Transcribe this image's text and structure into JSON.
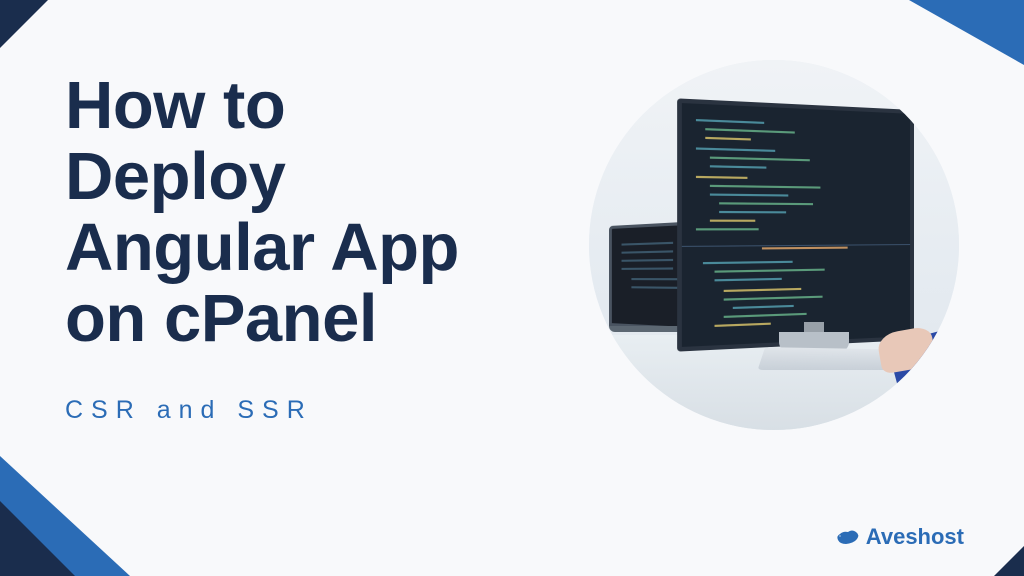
{
  "title_lines": [
    "How to",
    "Deploy",
    "Angular App",
    "on cPanel"
  ],
  "subtitle": "CSR and SSR",
  "brand": "Aveshost",
  "colors": {
    "primary": "#1a2d4d",
    "accent": "#2b6cb6"
  }
}
